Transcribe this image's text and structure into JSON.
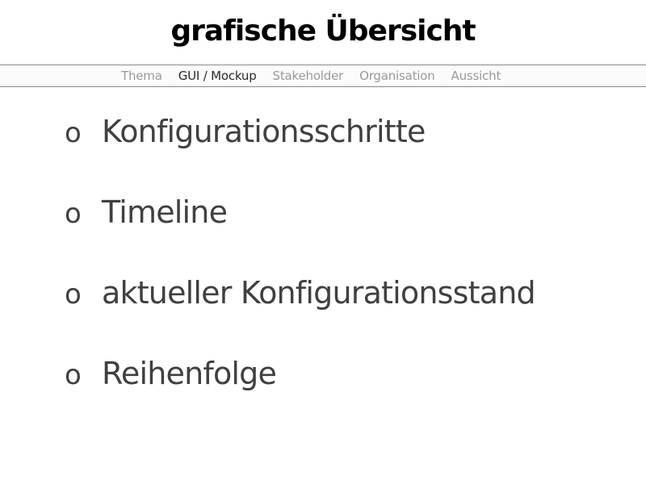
{
  "title": "grafische Übersicht",
  "nav": {
    "items": [
      {
        "label": "Thema"
      },
      {
        "label": "GUI / Mockup"
      },
      {
        "label": "Stakeholder"
      },
      {
        "label": "Organisation"
      },
      {
        "label": "Aussicht"
      }
    ],
    "active_item": "GUI / Mockup"
  },
  "bullets": [
    {
      "marker": "o",
      "text": "Konfigurationsschritte"
    },
    {
      "marker": "o",
      "text": "Timeline"
    },
    {
      "marker": "o",
      "text": "aktueller Konfigurationsstand"
    },
    {
      "marker": "o",
      "text": "Reihenfolge"
    }
  ],
  "colors": {
    "title": "#000000",
    "nav_active": "#2a2a2a",
    "nav_inactive": "#9a9a9a",
    "body_text": "#404040",
    "nav_border": "#8a8a8a"
  }
}
